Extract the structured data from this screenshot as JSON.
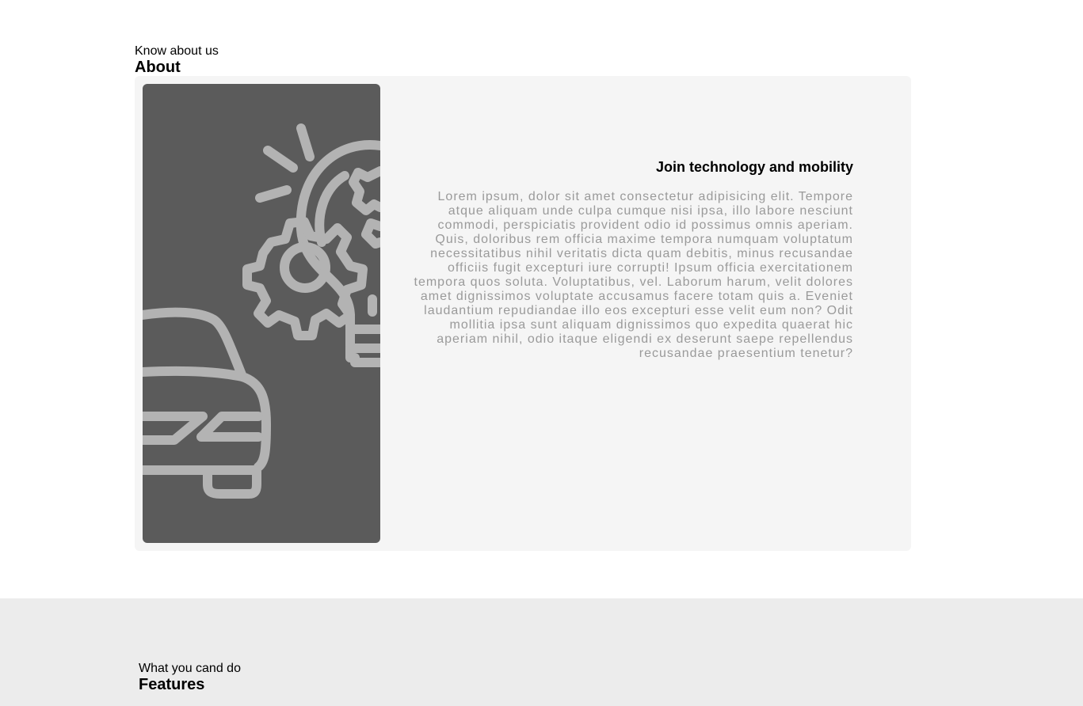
{
  "about": {
    "kicker": "Know about us",
    "heading": "About",
    "card": {
      "title": "Join technology and mobility",
      "body": "Lorem ipsum, dolor sit amet consectetur adipisicing elit. Tempore atque aliquam unde culpa cumque nisi ipsa, illo labore nesciunt commodi, perspiciatis provident odio id possimus omnis aperiam. Quis, doloribus rem officia maxime tempora numquam voluptatum necessitatibus nihil veritatis dicta quam debitis, minus recusandae officiis fugit excepturi iure corrupti! Ipsum officia exercitationem tempora quos soluta. Voluptatibus, vel. Laborum harum, velit dolores amet dignissimos voluptate accusamus facere totam quis a. Eveniet laudantium repudiandae illo eos excepturi esse velit eum non? Odit mollitia ipsa sunt aliquam dignissimos quo expedita quaerat hic aperiam nihil, odio itaque eligendi ex deserunt saepe repellendus recusandae praesentium tenetur?",
      "illustration_icons": [
        "car-icon",
        "lightbulb-gear-icon"
      ]
    }
  },
  "features": {
    "kicker": "What you cand do",
    "heading": "Features"
  },
  "colors": {
    "panel_bg": "#5b5b5b",
    "illustration_stroke": "#b3b3b3",
    "card_bg": "#f5f5f5",
    "body_text": "#9a9a9a",
    "features_bg": "#ececec"
  }
}
